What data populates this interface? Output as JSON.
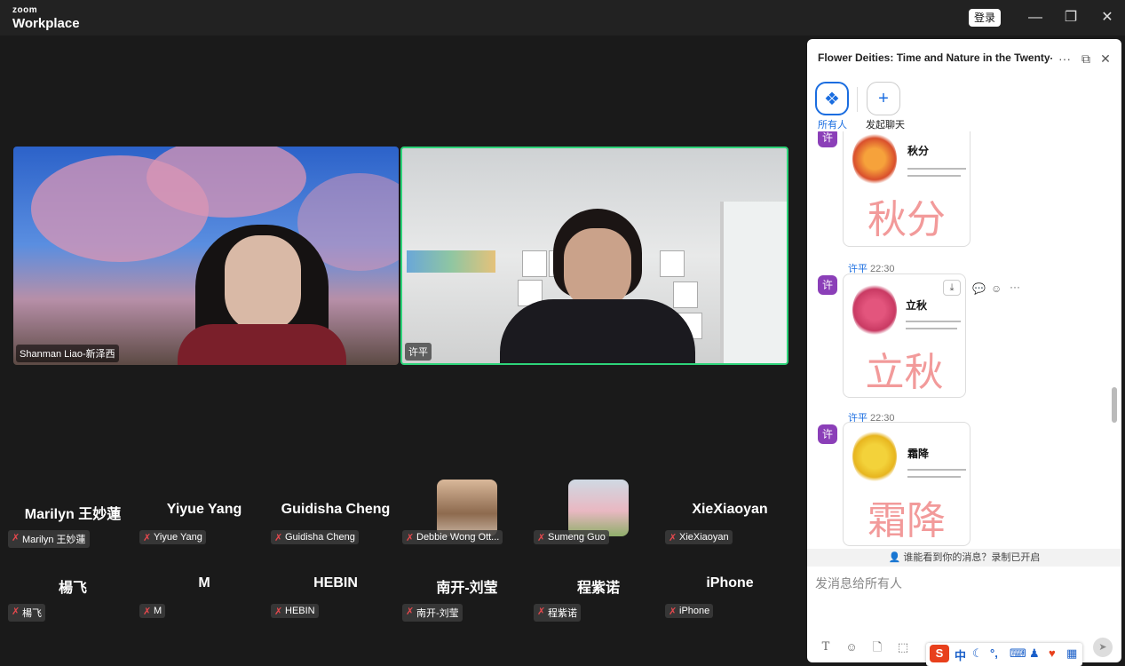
{
  "titlebar": {
    "logo_small": "zoom",
    "logo_large": "Workplace",
    "login_label": "登录",
    "minimize": "—",
    "restore": "❐",
    "close": "✕"
  },
  "videos": [
    {
      "name": "Shanman Liao-新泽西"
    },
    {
      "name": "许平"
    }
  ],
  "participants_row1": [
    {
      "display": "Marilyn 王妙蓮",
      "label": "Marilyn 王妙蓮"
    },
    {
      "display": "Yiyue Yang",
      "label": "Yiyue Yang"
    },
    {
      "display": "Guidisha Cheng",
      "label": "Guidisha Cheng"
    },
    {
      "display": "",
      "label": "Debbie Wong Ott..."
    },
    {
      "display": "",
      "label": "Sumeng Guo"
    },
    {
      "display": "XieXiaoyan",
      "label": "XieXiaoyan"
    }
  ],
  "participants_row2": [
    {
      "display": "楊飞",
      "label": "楊飞"
    },
    {
      "display": "M",
      "label": "M"
    },
    {
      "display": "HEBIN",
      "label": "HEBIN"
    },
    {
      "display": "南开-刘莹",
      "label": "南开-刘莹"
    },
    {
      "display": "程紫诺",
      "label": "程紫诺"
    },
    {
      "display": "iPhone",
      "label": "iPhone"
    }
  ],
  "chat": {
    "title": "Flower Deities: Time and Nature in the Twenty-...",
    "channel_everyone": "所有人",
    "channel_new": "发起聊天",
    "messages": [
      {
        "avatar": "许",
        "sender": "",
        "time": "",
        "title_cn": "秋分",
        "big_cn": "秋分"
      },
      {
        "avatar": "许",
        "sender": "许平",
        "time": "22:30",
        "title_cn": "立秋",
        "big_cn": "立秋"
      },
      {
        "avatar": "许",
        "sender": "许平",
        "time": "22:30",
        "title_cn": "霜降",
        "big_cn": "霜降"
      }
    ],
    "notice": "谁能看到你的消息？录制已开启",
    "compose_placeholder": "发消息给所有人"
  },
  "ime": {
    "lang": "中"
  },
  "colors": {
    "active_speaker_border": "#2ed47a",
    "accent_blue": "#1a6de0",
    "avatar_purple": "#8b3fb8",
    "muted_red": "#e5484d"
  }
}
